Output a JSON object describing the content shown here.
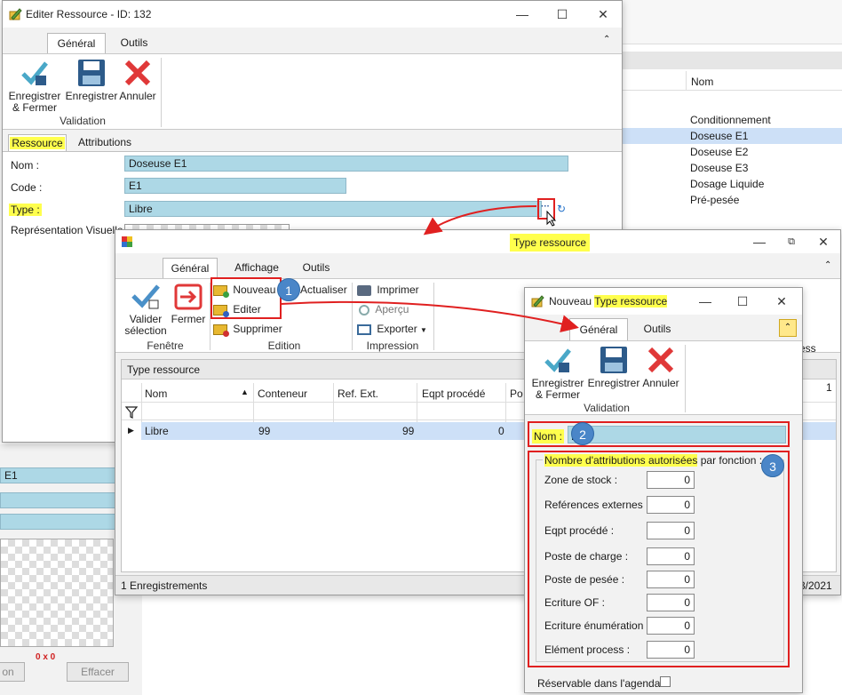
{
  "background_window": {
    "column_header": "Nom",
    "rows": [
      "Conditionnement",
      "Doseuse E1",
      "Doseuse E2",
      "Doseuse E3",
      "Dosage Liquide",
      "Pré-pesée"
    ],
    "left_strip_value": "E1",
    "size_label": "0 x 0",
    "button_left": "on",
    "button_effacer": "Effacer"
  },
  "edit_window": {
    "title": "Editer Ressource - ID: 132",
    "tabs": [
      "Général",
      "Outils"
    ],
    "ribbon": {
      "save_close": "Enregistrer & Fermer",
      "save": "Enregistrer",
      "cancel": "Annuler",
      "group": "Validation"
    },
    "subtabs": [
      "Ressource",
      "Attributions"
    ],
    "fields": {
      "nom_label": "Nom :",
      "nom_value": "Doseuse E1",
      "code_label": "Code :",
      "code_value": "E1",
      "type_label": "Type :",
      "type_value": "Libre",
      "repr_label": "Représentation Visuelle"
    }
  },
  "type_window": {
    "title": "Type ressource",
    "tabs": [
      "Général",
      "Affichage",
      "Outils"
    ],
    "ribbon": {
      "valider": "Valider sélection",
      "fermer": "Fermer",
      "group_fenetre": "Fenêtre",
      "nouveau": "Nouveau",
      "editer": "Editer",
      "supprimer": "Supprimer",
      "actualiser": "Actualiser",
      "group_edition": "Edition",
      "imprimer": "Imprimer",
      "apercu": "Aperçu",
      "exporter": "Exporter",
      "group_impression": "Impression"
    },
    "panel_title": "Type ressource",
    "columns": [
      "Nom",
      "Conteneur",
      "Ref. Ext.",
      "Eqpt procédé",
      "Po"
    ],
    "row": {
      "nom": "Libre",
      "conteneur": "99",
      "ref_ext": "99",
      "eqpt": "0"
    },
    "status": "1 Enregistrements",
    "right_partial_header": "ess",
    "right_partial_value": "1",
    "right_partial_date": "3/2021"
  },
  "new_window": {
    "title_prefix": "Nouveau",
    "title_highlight": "Type ressource",
    "tabs": [
      "Général",
      "Outils"
    ],
    "ribbon": {
      "save_close": "Enregistrer & Fermer",
      "save": "Enregistrer",
      "cancel": "Annuler",
      "group": "Validation"
    },
    "nom_label": "Nom :",
    "group_title_highlight": "Nombre d'attributions autorisées",
    "group_title_rest": " par fonction :",
    "counters": [
      {
        "label": "Zone de stock :",
        "value": "0"
      },
      {
        "label": "Reférences externes :",
        "value": "0"
      },
      {
        "label": "Eqpt procédé :",
        "value": "0"
      },
      {
        "label": "Poste de charge :",
        "value": "0"
      },
      {
        "label": "Poste de pesée :",
        "value": "0"
      },
      {
        "label": "Ecriture OF :",
        "value": "0"
      },
      {
        "label": "Ecriture énumération :",
        "value": "0"
      },
      {
        "label": "Elément process :",
        "value": "0"
      }
    ],
    "reservable": "Réservable dans l'agenda"
  },
  "badges": [
    "1",
    "2",
    "3"
  ],
  "colors": {
    "field_bg": "#add8e6",
    "highlight": "#ffff4d",
    "annotation_red": "#e02020",
    "badge": "#4a86c8",
    "selected_row": "#cde0f7"
  }
}
